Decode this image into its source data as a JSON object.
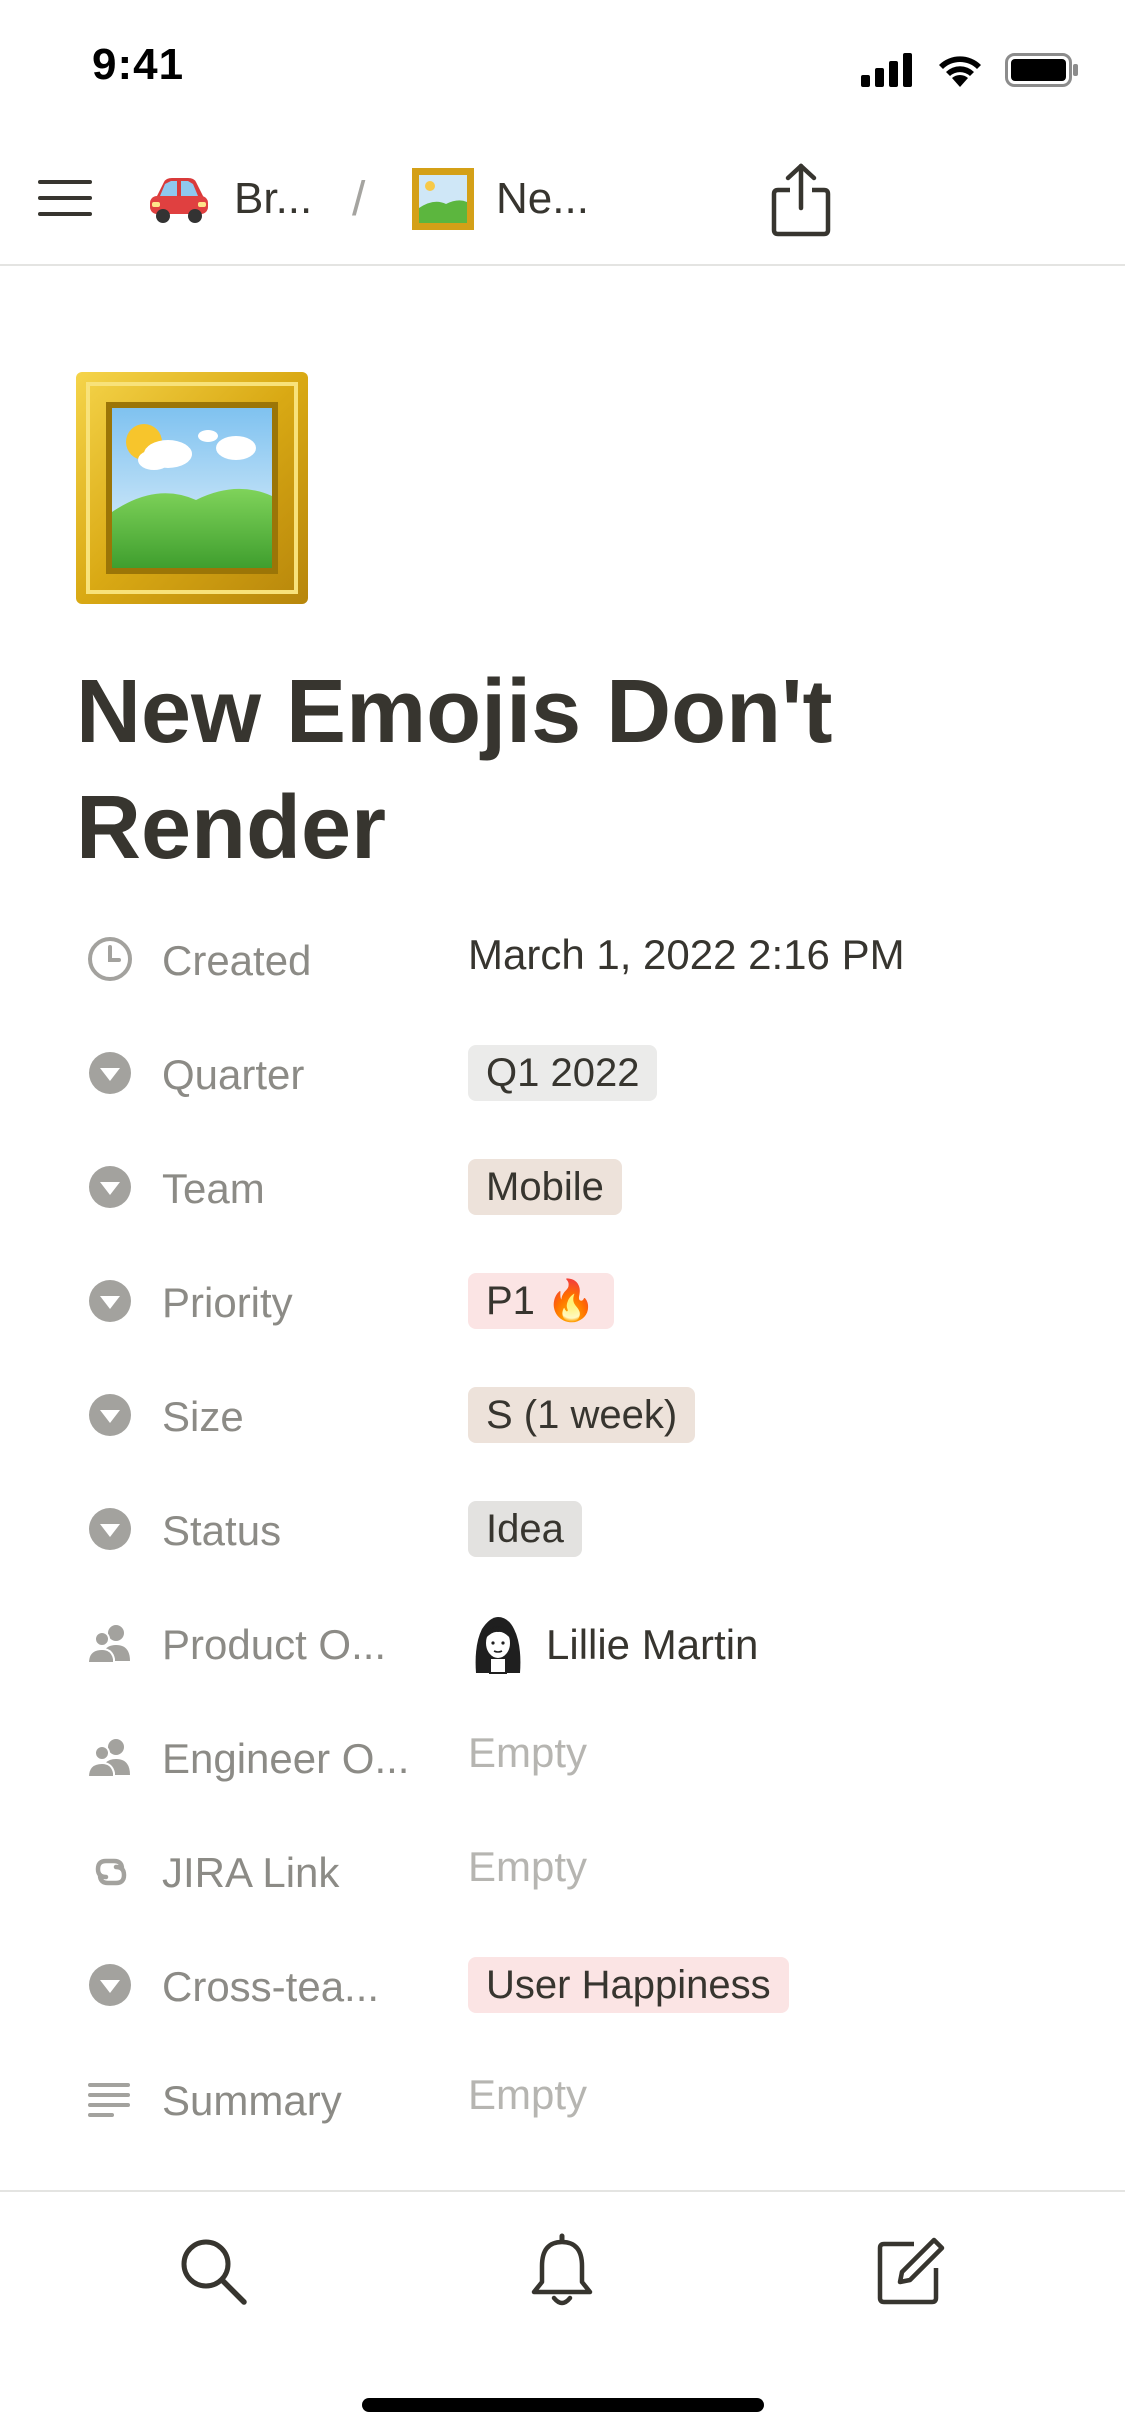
{
  "status_bar": {
    "time": "9:41",
    "icons": [
      "cellular-signal-icon",
      "wifi-icon",
      "battery-icon"
    ]
  },
  "nav": {
    "menu_icon": "hamburger-menu-icon",
    "breadcrumbs": [
      {
        "emoji": "🚘",
        "label": "Br..."
      },
      {
        "emoji": "🖼️",
        "label": "Ne..."
      }
    ],
    "separator": "/",
    "share_icon": "share-icon"
  },
  "page": {
    "icon": "framed-picture-emoji",
    "title": "New Emojis Don't Render"
  },
  "properties": [
    {
      "icon": "clock-icon",
      "label": "Created",
      "value": "March 1, 2022 2:16 PM",
      "type": "text"
    },
    {
      "icon": "select-icon",
      "label": "Quarter",
      "value": "Q1 2022",
      "type": "tag",
      "color": "#ebebea"
    },
    {
      "icon": "select-icon",
      "label": "Team",
      "value": "Mobile",
      "type": "tag",
      "color": "#ede2da"
    },
    {
      "icon": "select-icon",
      "label": "Priority",
      "value": "P1 🔥",
      "type": "tag",
      "color": "#fbe4e4"
    },
    {
      "icon": "select-icon",
      "label": "Size",
      "value": "S (1 week)",
      "type": "tag",
      "color": "#ede2da"
    },
    {
      "icon": "select-icon",
      "label": "Status",
      "value": "Idea",
      "type": "tag",
      "color": "#e3e2e0"
    },
    {
      "icon": "person-icon",
      "label": "Product O...",
      "value": "Lillie Martin",
      "type": "person"
    },
    {
      "icon": "person-icon",
      "label": "Engineer O...",
      "value": "Empty",
      "type": "empty"
    },
    {
      "icon": "link-icon",
      "label": "JIRA Link",
      "value": "Empty",
      "type": "empty"
    },
    {
      "icon": "select-icon",
      "label": "Cross-tea...",
      "value": "User Happiness",
      "type": "tag",
      "color": "#fbe4e4"
    },
    {
      "icon": "text-lines-icon",
      "label": "Summary",
      "value": "Empty",
      "type": "empty"
    }
  ],
  "bottom_bar": {
    "icons": [
      "search-icon",
      "bell-icon",
      "compose-icon"
    ]
  }
}
